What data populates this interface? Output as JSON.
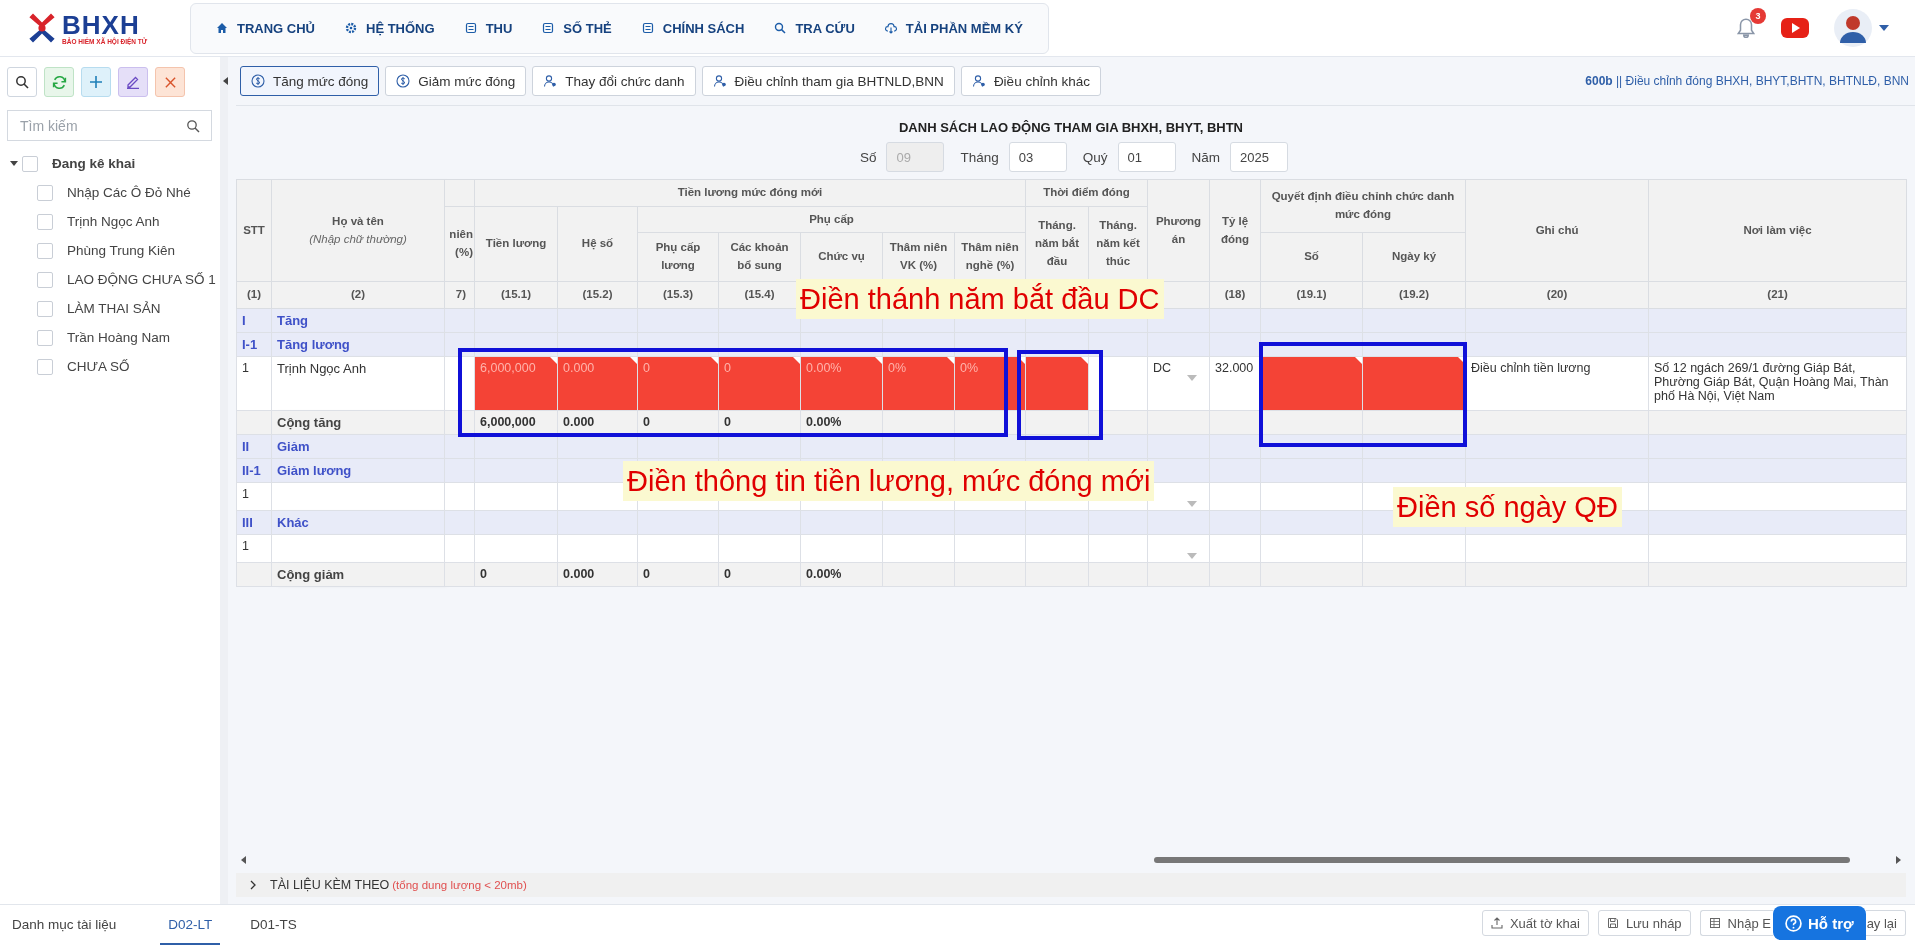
{
  "header": {
    "logo": {
      "name": "BHXH",
      "tagline": "BẢO HIỂM XÃ HỘI ĐIỆN TỬ"
    },
    "nav": [
      {
        "label": "TRANG CHỦ",
        "kind": "home"
      },
      {
        "label": "HỆ THỐNG",
        "kind": "gear"
      },
      {
        "label": "THU",
        "kind": "doc"
      },
      {
        "label": "SỐ THẺ",
        "kind": "doc"
      },
      {
        "label": "CHÍNH SÁCH",
        "kind": "doc"
      },
      {
        "label": "TRA CỨU",
        "kind": "search"
      },
      {
        "label": "TẢI PHẦN MỀM KÝ",
        "kind": "cloud"
      }
    ],
    "notifications": "3"
  },
  "sidebar": {
    "tools": [
      {
        "kind": "search"
      },
      {
        "kind": "refresh"
      },
      {
        "kind": "add"
      },
      {
        "kind": "edit"
      },
      {
        "kind": "close"
      }
    ],
    "search": {
      "placeholder": "Tìm kiếm"
    },
    "tree": [
      {
        "label": "Đang kê khai",
        "expanded": true,
        "checked": false,
        "children": [
          {
            "label": "Nhập Các Ô Đỏ Nhé",
            "checked": false
          },
          {
            "label": "Trịnh Ngọc Anh",
            "checked": false
          },
          {
            "label": "Phùng Trung Kiên",
            "checked": false
          },
          {
            "label": "LAO ĐỘNG CHƯA SỐ 1",
            "checked": false
          },
          {
            "label": "LÀM THAI SẢN",
            "checked": false
          },
          {
            "label": "Trần Hoàng Nam",
            "checked": false
          },
          {
            "label": "CHƯA SỐ",
            "checked": false
          }
        ]
      }
    ]
  },
  "tabs": [
    {
      "label": "Tăng mức đóng",
      "kind": "money",
      "selected": true
    },
    {
      "label": "Giảm mức đóng",
      "kind": "money",
      "selected": false
    },
    {
      "label": "Thay đổi chức danh",
      "kind": "person",
      "selected": false
    },
    {
      "label": "Điều chỉnh tham gia BHTNLD,BNN",
      "kind": "person",
      "selected": false
    },
    {
      "label": "Điều chỉnh khác",
      "kind": "person",
      "selected": false
    }
  ],
  "info": "**600b** || Điều chỉnh đóng BHXH, BHYT,BHTN, BHTNLĐ, BNN",
  "form": {
    "title": "DANH SÁCH LAO ĐỘNG THAM GIA BHXH, BHYT, BHTN",
    "fields": [
      {
        "label": "Số",
        "value": "09",
        "disabled": true
      },
      {
        "label": "Tháng",
        "value": "03",
        "disabled": false
      },
      {
        "label": "Quý",
        "value": "01",
        "disabled": false
      },
      {
        "label": "Năm",
        "value": "2025",
        "disabled": false
      }
    ]
  },
  "table": {
    "columns": {
      "stt": "STT",
      "name": "Họ và tên",
      "name_hint": "(Nhập chữ thường)",
      "cut": "niên (%)",
      "salary_group": "Tiền lương mức đóng mới",
      "salary": "Tiền lương",
      "coefficient": "Hệ số",
      "allowance_group": "Phụ cấp",
      "allowances": [
        "Phụ cấp lương",
        "Các khoản bổ sung",
        "Chức vụ",
        "Thâm niên VK (%)",
        "Thâm niên nghề (%)"
      ],
      "time_group": "Thời điểm đóng",
      "start": "Tháng. năm bắt đầu",
      "end": "Tháng. năm kết thúc",
      "plan": "Phương án",
      "rate": "Tỷ lệ đóng",
      "decision_group": "Quyết định điều chỉnh chức danh mức đóng",
      "number": "Số",
      "signed": "Ngày ký",
      "note": "Ghi chú",
      "workplace": "Nơi làm việc"
    },
    "numbers": {
      "stt": "(1)",
      "name": "(2)",
      "cut": "7)",
      "salary": "(15.1)",
      "coefficient": "(15.2)",
      "allowance_1": "(15.3)",
      "allowance_2": "(15.4)",
      "rate": "(18)",
      "number": "(19.1)",
      "signed": "(19.2)",
      "note": "(20)",
      "workplace": "(21)"
    },
    "rows": [
      {
        "kind": "group",
        "stt": "I",
        "name": "Tăng"
      },
      {
        "kind": "group",
        "stt": "I-1",
        "name": "Tăng lương"
      },
      {
        "kind": "entry",
        "stt": "1",
        "name": "Trịnh Ngọc Anh",
        "cells": [
          {
            "flagged": false
          },
          {
            "text": "6,000,000",
            "flagged": true
          },
          {
            "text": "0.000",
            "flagged": true
          },
          {
            "text": "0",
            "flagged": true
          },
          {
            "text": "0",
            "flagged": true
          },
          {
            "text": "0.00%",
            "flagged": true
          },
          {
            "text": "0%",
            "flagged": true
          },
          {
            "text": "0%",
            "flagged": true
          },
          {
            "flagged": true
          },
          {
            "flagged": false
          },
          {
            "kind": "select",
            "text": "DC",
            "flagged": false
          },
          {
            "text": "32.000",
            "flagged": false
          },
          {
            "flagged": true
          },
          {
            "flagged": true
          },
          {
            "text": "Điều chỉnh tiền lương",
            "flagged": false
          },
          {
            "text": "Số 12 ngách 269/1 đường Giáp Bát,\nPhường Giáp Bát, Quận Hoàng Mai, Thàn\nphố Hà Nội, Việt Nam",
            "flagged": false
          }
        ]
      },
      {
        "kind": "total",
        "name": "Cộng tăng",
        "cells": [
          {
            "flagged": false
          },
          {
            "text": "6,000,000",
            "flagged": false
          },
          {
            "text": "0.000",
            "flagged": false
          },
          {
            "text": "0",
            "flagged": false
          },
          {
            "text": "0",
            "flagged": false
          },
          {
            "text": "0.00%",
            "flagged": false
          },
          {
            "flagged": false
          },
          {
            "flagged": false
          },
          {
            "flagged": false
          },
          {
            "flagged": false
          },
          {
            "flagged": false
          },
          {
            "flagged": false
          },
          {
            "flagged": false
          },
          {
            "flagged": false
          },
          {
            "flagged": false
          },
          {
            "flagged": false
          }
        ]
      },
      {
        "kind": "group",
        "stt": "II",
        "name": "Giảm"
      },
      {
        "kind": "group",
        "stt": "II-1",
        "name": "Giảm lương"
      },
      {
        "kind": "entry",
        "stt": "1",
        "cells": [
          {
            "flagged": false
          },
          {
            "flagged": false
          },
          {
            "flagged": false
          },
          {
            "flagged": false
          },
          {
            "flagged": false
          },
          {
            "flagged": false
          },
          {
            "flagged": false
          },
          {
            "flagged": false
          },
          {
            "flagged": false
          },
          {
            "flagged": false
          },
          {
            "kind": "select",
            "flagged": false
          },
          {
            "flagged": false
          },
          {
            "flagged": false
          },
          {
            "flagged": false
          },
          {
            "flagged": false
          },
          {
            "flagged": false
          }
        ]
      },
      {
        "kind": "group",
        "stt": "III",
        "name": "Khác"
      },
      {
        "kind": "entry",
        "stt": "1",
        "cells": [
          {
            "flagged": false
          },
          {
            "flagged": false
          },
          {
            "flagged": false
          },
          {
            "flagged": false
          },
          {
            "flagged": false
          },
          {
            "flagged": false
          },
          {
            "flagged": false
          },
          {
            "flagged": false
          },
          {
            "flagged": false
          },
          {
            "flagged": false
          },
          {
            "kind": "select",
            "flagged": false
          },
          {
            "flagged": false
          },
          {
            "flagged": false
          },
          {
            "flagged": false
          },
          {
            "flagged": false
          },
          {
            "flagged": false
          }
        ]
      },
      {
        "kind": "total",
        "name": "Cộng giảm",
        "cells": [
          {
            "flagged": false
          },
          {
            "text": "0",
            "flagged": false
          },
          {
            "text": "0.000",
            "flagged": false
          },
          {
            "text": "0",
            "flagged": false
          },
          {
            "text": "0",
            "flagged": false
          },
          {
            "text": "0.00%",
            "flagged": false
          },
          {
            "flagged": false
          },
          {
            "flagged": false
          },
          {
            "flagged": false
          },
          {
            "flagged": false
          },
          {
            "flagged": false
          },
          {
            "flagged": false
          },
          {
            "flagged": false
          },
          {
            "flagged": false
          },
          {
            "flagged": false
          },
          {
            "flagged": false
          }
        ]
      }
    ]
  },
  "annotations": [
    {
      "kind": "note",
      "text": "Điền thánh năm bắt đầu DC"
    },
    {
      "kind": "box"
    },
    {
      "kind": "box"
    },
    {
      "kind": "box"
    },
    {
      "kind": "note",
      "text": "Điền thông tin tiền lương, mức đóng mới"
    },
    {
      "kind": "note",
      "text": "Điền số ngày QĐ"
    }
  ],
  "attachments": {
    "label": "TÀI LIỆU KÈM THEO",
    "note": "(tổng dung lượng < 20mb)"
  },
  "footer": {
    "tabs": [
      {
        "label": "Danh mục tài liệu",
        "selected": false
      },
      {
        "label": "D02-LT",
        "selected": true
      },
      {
        "label": "D01-TS",
        "selected": false
      }
    ],
    "actions": [
      {
        "label": "Xuất tờ khai",
        "kind": "upload"
      },
      {
        "label": "Lưu nháp",
        "kind": "save"
      },
      {
        "label": "Nhập E",
        "kind": "sheet"
      },
      {
        "label": "ay lại",
        "kind": "plain"
      }
    ],
    "help": "Hỗ trợ"
  }
}
